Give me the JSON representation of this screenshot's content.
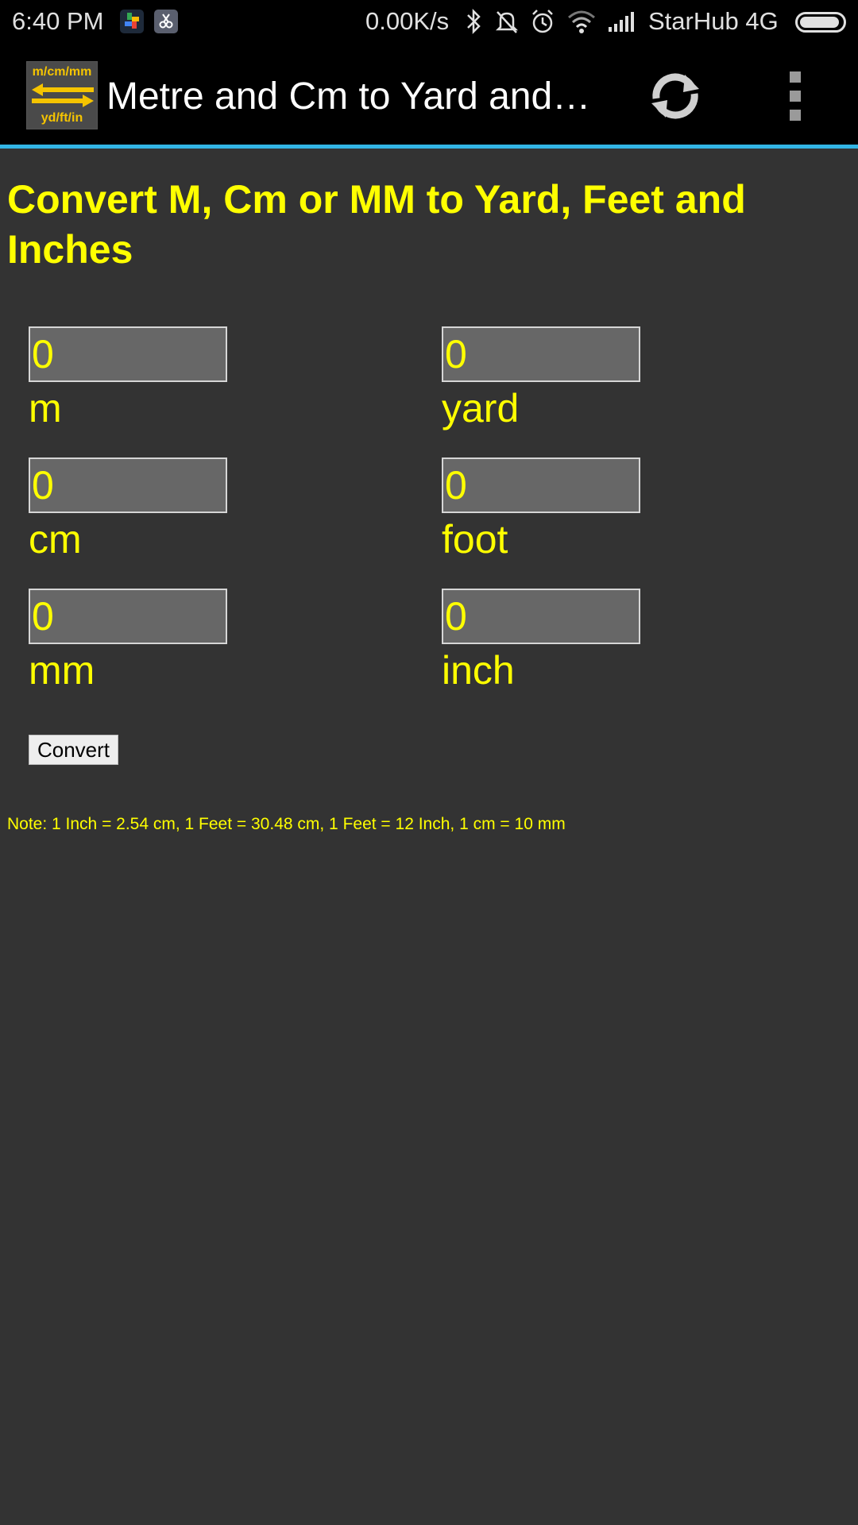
{
  "status_bar": {
    "time": "6:40 PM",
    "net_speed": "0.00K/s",
    "carrier": "StarHub 4G",
    "battery_level": 0.95
  },
  "action_bar": {
    "logo_top": "m/cm/mm",
    "logo_bottom": "yd/ft/in",
    "title": "Metre and Cm to Yard and…",
    "accent_color": "#33b5e5"
  },
  "main": {
    "heading": "Convert M, Cm or MM to Yard, Feet and Inches",
    "metric_fields": [
      {
        "value": "0",
        "label": "m"
      },
      {
        "value": "0",
        "label": "cm"
      },
      {
        "value": "0",
        "label": "mm"
      }
    ],
    "imperial_fields": [
      {
        "value": "0",
        "label": "yard"
      },
      {
        "value": "0",
        "label": "foot"
      },
      {
        "value": "0",
        "label": "inch"
      }
    ],
    "convert_label": "Convert",
    "note": "Note: 1 Inch = 2.54 cm, 1 Feet = 30.48 cm, 1 Feet = 12 Inch, 1 cm = 10 mm",
    "text_color": "#ffff00",
    "background_color": "#333333"
  }
}
